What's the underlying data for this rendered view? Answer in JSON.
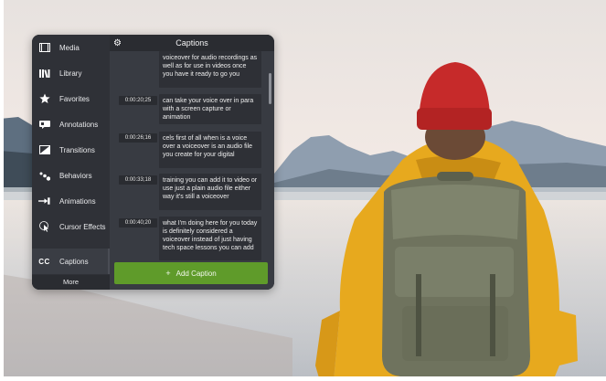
{
  "sidebar": {
    "items": [
      {
        "label": "Media",
        "icon": "film-icon"
      },
      {
        "label": "Library",
        "icon": "library-icon"
      },
      {
        "label": "Favorites",
        "icon": "star-icon"
      },
      {
        "label": "Annotations",
        "icon": "annotation-icon"
      },
      {
        "label": "Transitions",
        "icon": "transition-icon"
      },
      {
        "label": "Behaviors",
        "icon": "behaviors-icon"
      },
      {
        "label": "Animations",
        "icon": "animation-icon"
      },
      {
        "label": "Cursor Effects",
        "icon": "cursor-icon"
      },
      {
        "label": "Captions",
        "icon": "cc-icon",
        "active": true
      }
    ],
    "more_label": "More"
  },
  "captions_panel": {
    "title": "Captions",
    "captions": [
      {
        "time": "",
        "text": "voiceover for audio recordings as well as for use in videos once you have it ready to go you"
      },
      {
        "time": "0:00:20;25",
        "text": "can take your voice over in para with a screen capture or animation"
      },
      {
        "time": "0:00:26;16",
        "text": "cels first of all when is a voice over a voiceover is an audio file you create for your digital"
      },
      {
        "time": "0:00:33;18",
        "text": "training you can add it to video or use just a plain audio file either way it's still a voiceover"
      },
      {
        "time": "0:00:40;20",
        "text": "what I'm doing here for you today is definitely considered a voiceover instead of just having tech space lessons you can add"
      }
    ],
    "add_button_label": "Add Caption"
  },
  "colors": {
    "panel_bg": "#2b2d33",
    "accent_green": "#5f9b2a"
  }
}
